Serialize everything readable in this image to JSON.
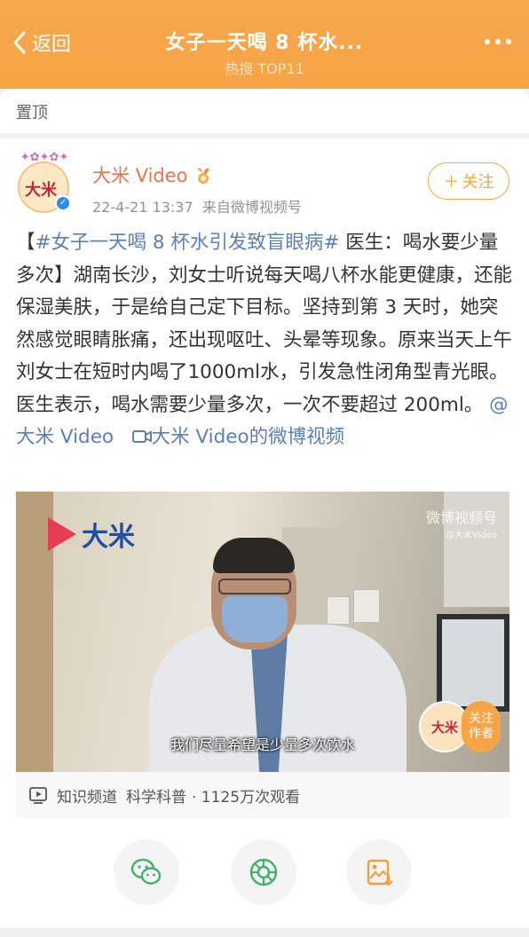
{
  "header": {
    "back_label": "返回",
    "title": "女子一天喝 8 杯水...",
    "subtitle": "热搜 TOP11"
  },
  "pinned": {
    "label": "置顶"
  },
  "post": {
    "author": "大米 Video",
    "avatar_text": "大米",
    "time": "22-4-21 13:37",
    "source": "来自微博视频号",
    "follow_label": "关注",
    "hashtag": "#女子一天喝 8 杯水引发致盲眼病#",
    "text_open": "【",
    "text_after_tag": " 医生：喝水要少量多次】湖南长沙，刘女士听说每天喝八杯水能更健康，还能保湿美肤，于是给自己定下目标。坚持到第 3 天时，她突然感觉眼睛胀痛，还出现呕吐、头晕等现象。原来当天上午刘女士在短时内喝了1000ml水，引发急性闭角型青光眼。医生表示，喝水需要少量多次，一次不要超过 200ml。",
    "mention": "@大米 Video",
    "video_link": "大米 Video的微博视频"
  },
  "video": {
    "logo_text": "大米",
    "watermark_line1": "微博视频号",
    "watermark_line2": "@大米Video",
    "caption": "我们尽量希望是少量多次饮水",
    "follow_author_line1": "关注",
    "follow_author_line2": "作者",
    "info_channel": "知识频道",
    "info_category": "科学科普",
    "info_views": "· 1125万次观看"
  },
  "share": {
    "icons": [
      "wechat-icon",
      "moments-icon",
      "save-image-icon"
    ]
  },
  "colors": {
    "header_bg": "#f5a446",
    "username": "#eb7350",
    "link": "#5b7fbb"
  }
}
